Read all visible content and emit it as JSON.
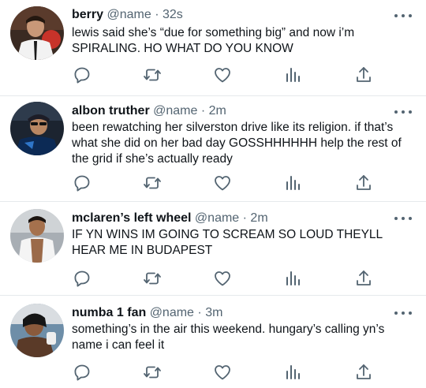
{
  "tweets": [
    {
      "name": "berry",
      "handle": "@name",
      "sep": "·",
      "time": "32s",
      "text": "lewis said she’s “due for something big” and now i’m SPIRALING. HO WHAT DO YOU KNOW"
    },
    {
      "name": "albon truther",
      "handle": "@name",
      "sep": "·",
      "time": "2m",
      "text": "been rewatching her silverston drive like its religion. if that’s what she did on her bad day GOSSHHHHHH help the rest of the grid if she’s actually ready"
    },
    {
      "name": "mclaren’s left wheel",
      "handle": "@name",
      "sep": "·",
      "time": "2m",
      "text": "IF YN WINS IM GOING TO SCREAM SO LOUD THEYLL HEAR ME IN BUDAPEST"
    },
    {
      "name": "numba 1 fan",
      "handle": "@name",
      "sep": "·",
      "time": "3m",
      "text": "something’s in the air this weekend. hungary’s calling yn’s name i can feel it"
    }
  ],
  "icons": {
    "reply": "reply-icon",
    "retweet": "retweet-icon",
    "like": "heart-icon",
    "views": "views-icon",
    "share": "share-icon",
    "more": "more-icon"
  },
  "colors": {
    "text": "#0f1419",
    "secondary": "#536471",
    "icon": "#536471",
    "divider": "#e6e9ec"
  }
}
